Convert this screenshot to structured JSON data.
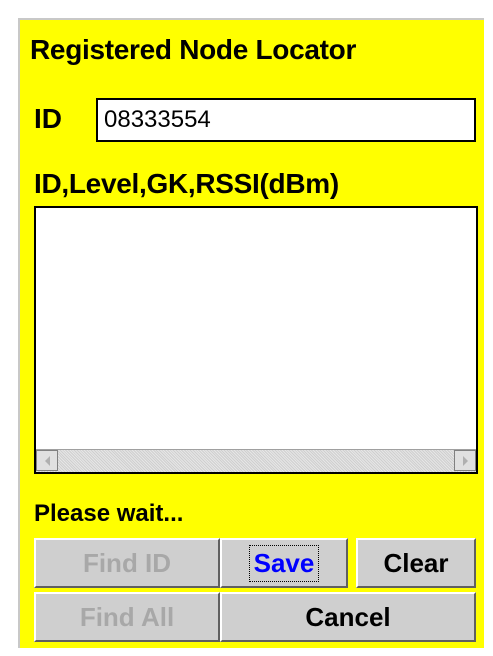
{
  "window": {
    "title": "Registered Node Locator"
  },
  "id_field": {
    "label": "ID",
    "value": "08333554"
  },
  "results": {
    "header": "ID,Level,GK,RSSI(dBm)",
    "rows": []
  },
  "status": {
    "text": "Please wait..."
  },
  "buttons": {
    "find_id": "Find ID",
    "save": "Save",
    "clear": "Clear",
    "find_all": "Find All",
    "cancel": "Cancel"
  },
  "colors": {
    "background": "#ffff00",
    "focus_text": "#0000ff",
    "disabled_text": "#a8a8a8"
  }
}
